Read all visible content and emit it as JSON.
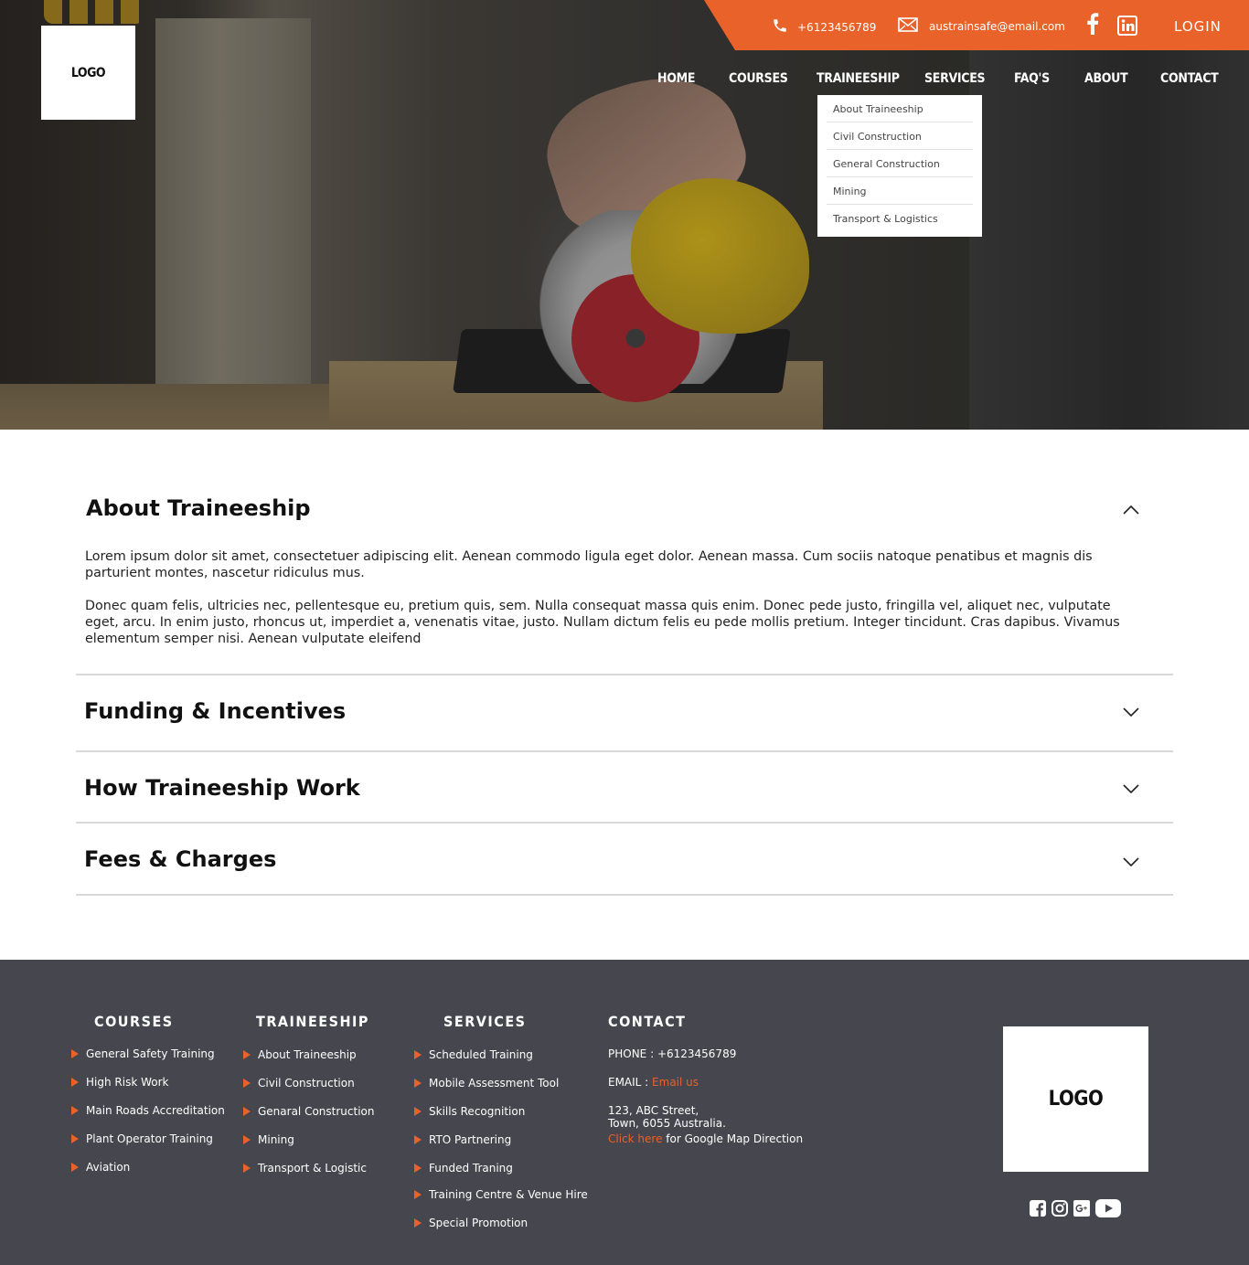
{
  "header": {
    "logo_text": "LOGO",
    "phone": "+6123456789",
    "email": "austrainsafe@email.com",
    "login_label": "LOGIN",
    "social_icons": [
      "facebook-icon",
      "linkedin-icon"
    ],
    "accent_color": "#e8622a"
  },
  "nav": {
    "items": [
      "HOME",
      "COURSES",
      "TRAINEESHIP",
      "SERVICES",
      "FAQ'S",
      "ABOUT",
      "CONTACT"
    ],
    "active": "TRAINEESHIP",
    "dropdown": [
      "About Traineeship",
      "Civil Construction",
      "General Construction",
      "Mining",
      "Transport & Logistics"
    ]
  },
  "accordion": {
    "sections": [
      {
        "title": "About Traineeship",
        "expanded": true,
        "paragraphs": [
          "Lorem ipsum dolor sit amet, consectetuer adipiscing elit. Aenean commodo ligula eget dolor. Aenean massa. Cum sociis natoque penatibus et magnis dis parturient montes, nascetur ridiculus mus.",
          "Donec quam felis, ultricies nec, pellentesque eu, pretium quis, sem. Nulla consequat massa quis enim. Donec pede justo, fringilla vel, aliquet nec, vulputate eget, arcu. In enim justo, rhoncus ut, imperdiet a, venenatis vitae, justo. Nullam dictum felis eu pede mollis pretium. Integer tincidunt. Cras dapibus. Vivamus elementum semper nisi. Aenean vulputate eleifend"
        ]
      },
      {
        "title": "Funding & Incentives",
        "expanded": false
      },
      {
        "title": "How Traineeship Work",
        "expanded": false
      },
      {
        "title": "Fees & Charges",
        "expanded": false
      }
    ]
  },
  "footer": {
    "courses": {
      "title": "COURSES",
      "items": [
        "General Safety Training",
        "High Risk Work",
        "Main Roads Accreditation",
        "Plant Operator Training",
        "Aviation"
      ]
    },
    "traineeship": {
      "title": "TRAINEESHIP",
      "items": [
        "About Traineeship",
        "Civil Construction",
        "Genaral Construction",
        "Mining",
        "Transport & Logistic"
      ]
    },
    "services": {
      "title": "SERVICES",
      "items": [
        "Scheduled Training",
        "Mobile Assessment Tool",
        "Skills Recognition",
        "RTO Partnering",
        "Funded Traning",
        "Training Centre & Venue Hire",
        "Special Promotion"
      ]
    },
    "contact": {
      "title": "CONTACT",
      "phone_label": "PHONE : ",
      "phone": "+6123456789",
      "email_label": "EMAIL : ",
      "email_link": "Email us",
      "address_line1": "123, ABC Street,",
      "address_line2": "Town, 6055 Australia.",
      "map_link": "Click here",
      "map_text": " for Google Map Direction"
    },
    "logo_text": "LOGO",
    "social_icons": [
      "facebook-square-icon",
      "instagram-icon",
      "google-plus-icon",
      "youtube-icon"
    ],
    "background_color": "#46464e"
  }
}
